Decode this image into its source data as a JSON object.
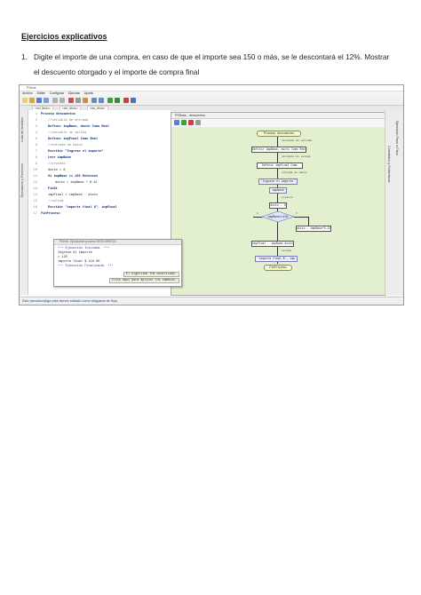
{
  "heading": "Ejercicios explicativos",
  "exercise": {
    "number": "1.",
    "text_line1": "Digite el importe de una compra, en caso de que el importe sea 150 o más, se le descontará el 12%. Mostrar",
    "text_line2": "el descuento otorgado y el importe de compra final"
  },
  "app": {
    "window_title": "PSeInt",
    "menu": [
      "Archivo",
      "Editar",
      "Configurar",
      "Ejecutar",
      "Ayuda"
    ],
    "tabs": [
      "<sin_titulo>",
      "<sin_titulo>",
      "<sin_titulo>"
    ],
    "left_panel_labels": [
      "Lista de Variables",
      "Operadores y Funciones"
    ],
    "right_panel_labels": [
      "Comandos y Estructuras",
      "Ejecución Paso a Paso"
    ],
    "status": "Este pseudocódigo está siendo editado como diagrama de flujo.",
    "colors": {
      "canvas": "#e2f0cf",
      "keyword": "#0a2a7a",
      "status": "#1f3f9f"
    }
  },
  "code": [
    {
      "n": "1",
      "text": "Proceso descuentos",
      "kind": "kw",
      "indent": 0
    },
    {
      "n": "2",
      "text": "//variable de entrada",
      "kind": "cm",
      "indent": 1
    },
    {
      "n": "3",
      "text": "Definir impBase, dscto Como Real",
      "kind": "kw",
      "indent": 1
    },
    {
      "n": "4",
      "text": "//variable de salida",
      "kind": "cm",
      "indent": 1
    },
    {
      "n": "5",
      "text": "Definir impFinal Como Real",
      "kind": "kw",
      "indent": 1
    },
    {
      "n": "6",
      "text": "//entrada de datos",
      "kind": "cm",
      "indent": 1
    },
    {
      "n": "7",
      "text": "Escribir \"Ingrese el importe\"",
      "kind": "kw",
      "indent": 1
    },
    {
      "n": "8",
      "text": "Leer impBase",
      "kind": "kw",
      "indent": 1
    },
    {
      "n": "9",
      "text": "//proceso",
      "kind": "cm",
      "indent": 1
    },
    {
      "n": "10",
      "text": "dscto = 0",
      "kind": "tx",
      "indent": 1
    },
    {
      "n": "11",
      "text": "Si impBase >= 150 Entonces",
      "kind": "kw",
      "indent": 1
    },
    {
      "n": "12",
      "text": "dscto = impBase * 0.12",
      "kind": "tx",
      "indent": 2
    },
    {
      "n": "13",
      "text": "FinSi",
      "kind": "kw",
      "indent": 1
    },
    {
      "n": "14",
      "text": "impFinal = impBase - dscto",
      "kind": "tx",
      "indent": 1
    },
    {
      "n": "15",
      "text": "//salida",
      "kind": "cm",
      "indent": 1
    },
    {
      "n": "16",
      "text": "Escribir \"importe final $\", impFinal",
      "kind": "kw",
      "indent": 1
    },
    {
      "n": "17",
      "text": "FinProceso",
      "kind": "kw",
      "indent": 0
    }
  ],
  "console": {
    "title": "PSeInt - Ejecutando proceso DESCUENTOS",
    "lines": [
      "*** Ejecución Iniciada. ***",
      "Ingrese el importe",
      "> 125",
      "importe final $ 110.00",
      "*** Ejecución Finalizada. ***"
    ],
    "note1": "El algoritmo fue modificado.",
    "note2": "Click aquí para aplicar los cambios."
  },
  "flow": {
    "title": "PSDraw - descuentos",
    "nodes": {
      "start": "Proceso descuentos",
      "comment1": "variable de entrada",
      "def1": "Definir impBase, dscto Como Real",
      "comment2": "variable de salida",
      "def2": "Definir impFinal Como",
      "comment3": "entrada de datos",
      "out1": "'Ingrese el importe'",
      "in1": "impBase",
      "comment4": "proceso",
      "assign0": "dscto ← 0",
      "cond": "impBase>=150",
      "assign1": "dscto ← impBase*0.12",
      "assign2": "impFinal ← impBase-dscto",
      "comment5": "salida",
      "out2": "'importe final $', imp",
      "end": "FinProceso"
    },
    "yes_label": "V",
    "no_label": "F"
  }
}
